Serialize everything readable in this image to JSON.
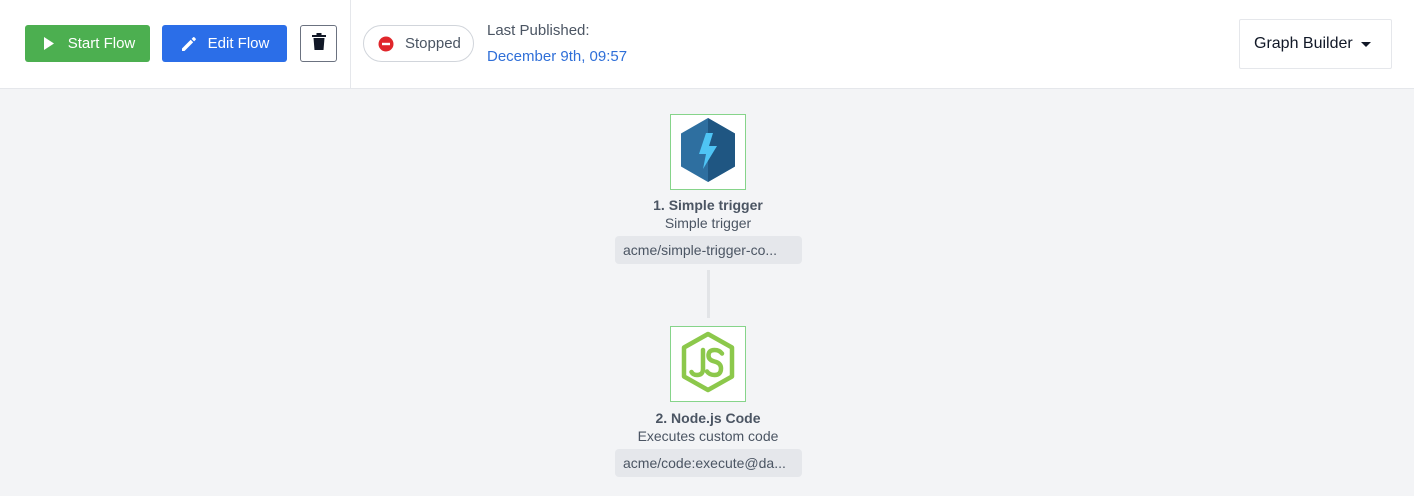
{
  "toolbar": {
    "start_label": "Start Flow",
    "edit_label": "Edit Flow",
    "status": "Stopped",
    "published_label": "Last Published:",
    "published_date": "December 9th, 09:57",
    "view_select": "Graph Builder"
  },
  "colors": {
    "start": "#4caf50",
    "edit": "#2b6ee8",
    "stopped": "#e0262b",
    "link": "#2f6fd8",
    "node_border": "#86d48a"
  },
  "flow": {
    "nodes": [
      {
        "title": "1. Simple trigger",
        "description": "Simple trigger",
        "component": "acme/simple-trigger-co...",
        "icon": "lightning-hexagon-icon"
      },
      {
        "title": "2. Node.js Code",
        "description": "Executes custom code",
        "component": "acme/code:execute@da...",
        "icon": "nodejs-icon"
      }
    ]
  }
}
